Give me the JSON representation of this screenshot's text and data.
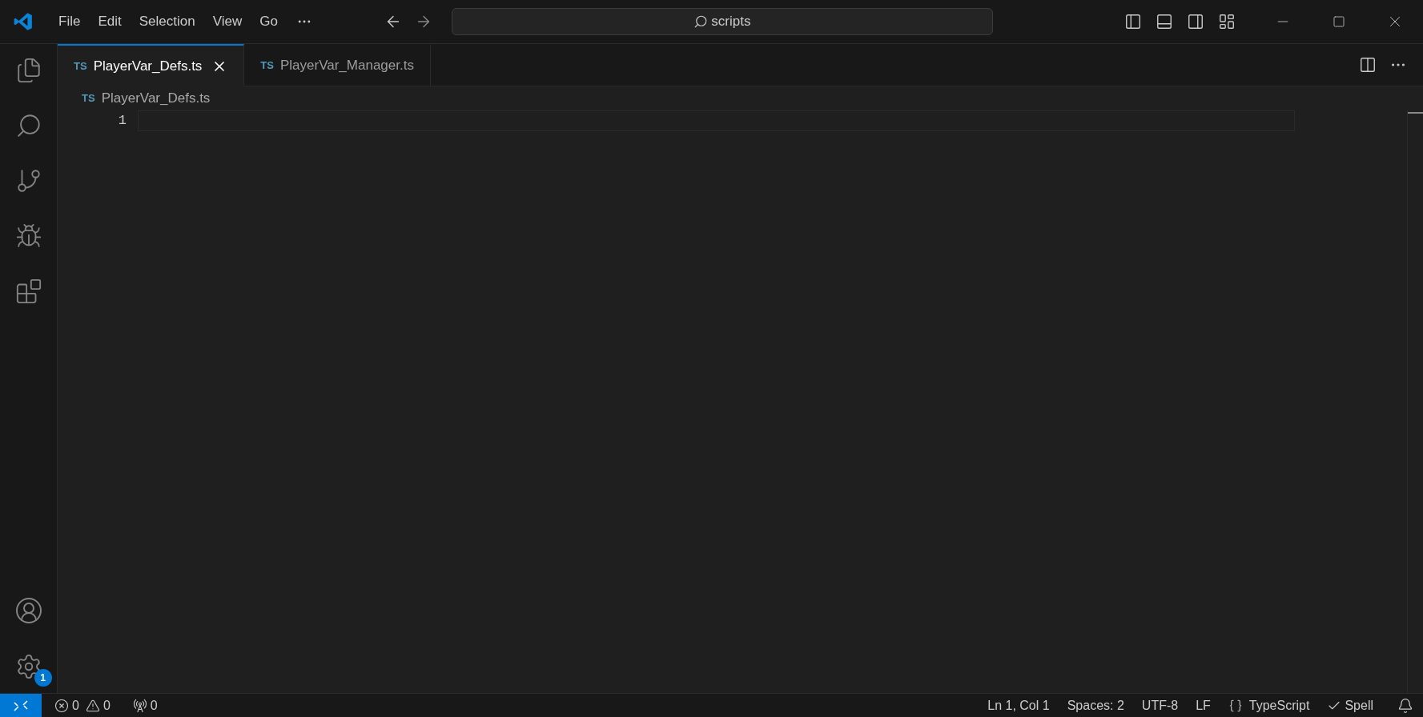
{
  "menu": [
    "File",
    "Edit",
    "Selection",
    "View",
    "Go"
  ],
  "search": {
    "value": "scripts"
  },
  "tabs": [
    {
      "icon_label": "TS",
      "label": "PlayerVar_Defs.ts",
      "selected": true
    },
    {
      "icon_label": "TS",
      "label": "PlayerVar_Manager.ts",
      "selected": false
    }
  ],
  "breadcrumb": {
    "icon_label": "TS",
    "label": "PlayerVar_Defs.ts"
  },
  "editor": {
    "line_numbers": [
      "1"
    ]
  },
  "activity_bar": {
    "settings_badge": "1"
  },
  "status_bar": {
    "errors": "0",
    "warnings": "0",
    "ports": "0",
    "items": [
      {
        "kind": "text",
        "label": "Ln 1, Col 1"
      },
      {
        "kind": "text",
        "label": "Spaces: 2"
      },
      {
        "kind": "text",
        "label": "UTF-8"
      },
      {
        "kind": "text",
        "label": "LF"
      },
      {
        "kind": "language",
        "label": "TypeScript"
      },
      {
        "kind": "check",
        "label": "Spell"
      }
    ]
  }
}
